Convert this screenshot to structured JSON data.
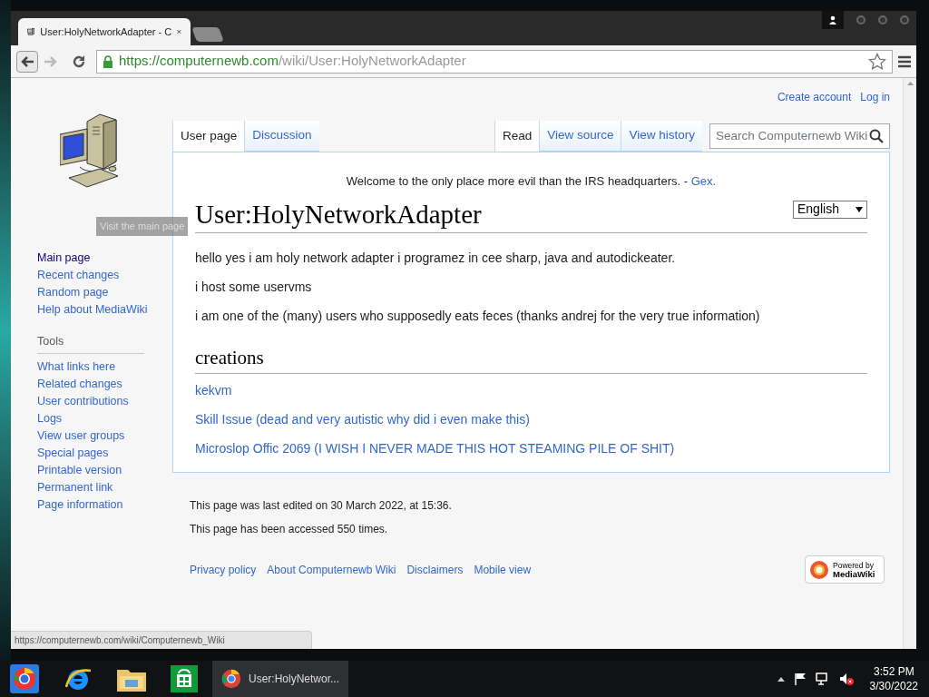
{
  "browser": {
    "tabs": [
      {
        "title": "User:HolyNetworkAdapter - C",
        "selected": true
      }
    ],
    "url_host": "https://computernewb.com",
    "url_path": "/wiki/User:HolyNetworkAdapter",
    "status_url": "https://computernewb.com/wiki/Computernewb_Wiki"
  },
  "personal_links": [
    "Create account",
    "Log in"
  ],
  "tooltip": "Visit the main page",
  "sidebar": {
    "navigation": [
      "Main page",
      "Recent changes",
      "Random page",
      "Help about MediaWiki"
    ],
    "tools_heading": "Tools",
    "tools": [
      "What links here",
      "Related changes",
      "User contributions",
      "Logs",
      "View user groups",
      "Special pages",
      "Printable version",
      "Permanent link",
      "Page information"
    ]
  },
  "page_tabs_left": [
    {
      "label": "User page",
      "selected": true
    },
    {
      "label": "Discussion",
      "selected": false
    }
  ],
  "page_tabs_right": [
    {
      "label": "Read",
      "selected": true
    },
    {
      "label": "View source",
      "selected": false
    },
    {
      "label": "View history",
      "selected": false
    }
  ],
  "search": {
    "placeholder": "Search Computernewb Wiki"
  },
  "sitenotice": {
    "text": "Welcome to the only place more evil than the IRS headquarters. -",
    "link": "Gex."
  },
  "title": "User:HolyNetworkAdapter",
  "language": "English",
  "paragraphs": [
    "hello yes i am holy network adapter i programez in cee sharp, java and autodickeater.",
    "i host some uservms",
    "i am one of the (many) users who supposedly eats feces (thanks andrej for the very true information)"
  ],
  "section_heading": "creations",
  "links": [
    "kekvm",
    "Skill Issue (dead and very autistic why did i even make this)",
    "Microslop Offic 2069 (I WISH I NEVER MADE THIS HOT STEAMING PILE OF SHIT)"
  ],
  "footer": {
    "info": [
      "This page was last edited on 30 March 2022, at 15:36.",
      "This page has been accessed 550 times."
    ],
    "links": [
      "Privacy policy",
      "About Computernewb Wiki",
      "Disclaimers",
      "Mobile view"
    ],
    "powered_by": [
      "Powered by",
      "MediaWiki"
    ]
  },
  "taskbar": {
    "window_title": "User:HolyNetwor...",
    "time": "3:52 PM",
    "date": "3/30/2022"
  }
}
